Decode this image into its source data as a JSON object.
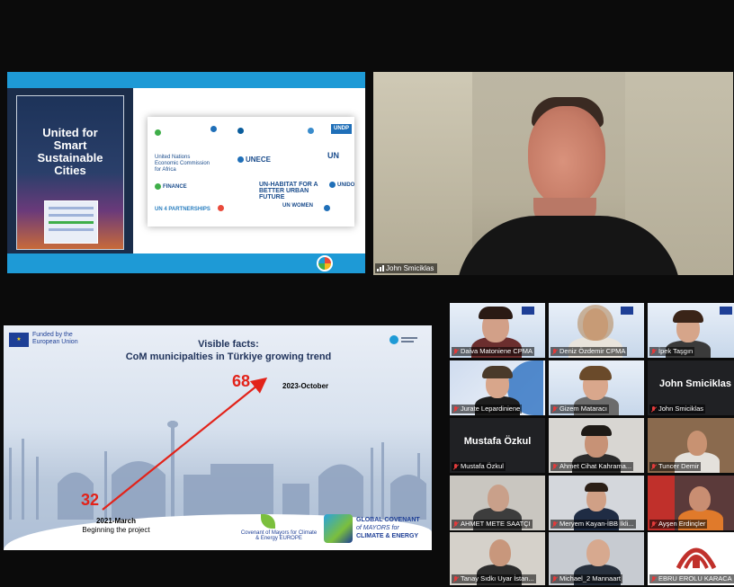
{
  "top_slide": {
    "title": "United for Smart Sustainable Cities",
    "logos": [
      "United Nations Economic Commission for Africa",
      "UNECE",
      "UN-HABITAT FOR A BETTER URBAN FUTURE",
      "UN WOMEN",
      "UN 4 PARTNERSHIPS",
      "UNDP",
      "UNIDO",
      "FINANCE"
    ]
  },
  "speaker": {
    "name": "John Smiciklas"
  },
  "bottom_slide": {
    "funded_by": "Funded by the European Union",
    "title_line1": "Visible facts:",
    "title_line2": "CoM municipalties in Türkiye growing trend",
    "value_end": "68",
    "label_end": "2023-October",
    "value_start": "32",
    "label_start_line1": "2021-March",
    "label_start_line2": "Beginning the project",
    "com_logo_text": "Covenant of Mayors for Climate & Energy EUROPE",
    "gcom_line1": "GLOBAL COVENANT",
    "gcom_line2": "of MAYORS for",
    "gcom_line3": "CLIMATE & ENERGY"
  },
  "gallery": [
    {
      "name": "Daiva Matoniene CPMA",
      "muted": true
    },
    {
      "name": "Deniz Özdemir CPMA",
      "muted": true
    },
    {
      "name": "İpek Taşgın",
      "muted": true
    },
    {
      "name": "Jurate Lepardiniene",
      "muted": true
    },
    {
      "name": "Gizem Mataracı",
      "muted": true
    },
    {
      "name": "John Smiciklas",
      "big_name": "John Smiciklas",
      "muted": true
    },
    {
      "name": "Mustafa Özkul",
      "big_name": "Mustafa Özkul",
      "muted": true
    },
    {
      "name": "Ahmet Cihat Kahrama...",
      "muted": true
    },
    {
      "name": "Tuncer Demir",
      "muted": true
    },
    {
      "name": "AHMET METE SAATÇI",
      "muted": true
    },
    {
      "name": "Meryem Kayan-İBB İkli...",
      "muted": true
    },
    {
      "name": "Ayşen Erdinçler",
      "muted": true
    },
    {
      "name": "Tanay Sıdkı Uyar İstan...",
      "muted": true
    },
    {
      "name": "Michael_2 Mannaart",
      "muted": true
    },
    {
      "name": "EBRU EROLU KARACA",
      "muted": true
    }
  ],
  "colors": {
    "accent_blue": "#1e9ad6",
    "highlight_red": "#e2231a",
    "eu_blue": "#1e3f96"
  }
}
